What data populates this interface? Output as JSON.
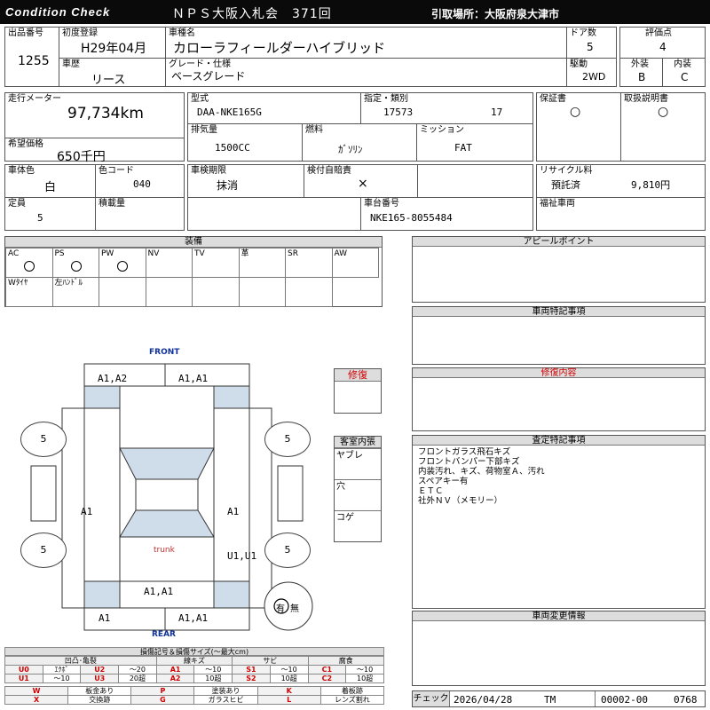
{
  "header": {
    "brand": "Condition  Check",
    "auction": "ＮＰＳ大阪入札会　371回",
    "pickup": "引取場所：大阪府泉大津市"
  },
  "vehicle": {
    "lot_label": "出品番号",
    "lot_no": "1255",
    "first_reg_label": "初度登録",
    "first_reg": "H29年04月",
    "name_label": "車種名",
    "name": "カローラフィールダーハイブリッド",
    "doors_label": "ドア数",
    "doors": "5",
    "score_label": "評価点",
    "score": "4",
    "history_label": "車歴",
    "history": "リース",
    "grade_label": "グレード・仕様",
    "grade": "ベースグレード",
    "drive_label": "駆動",
    "drive": "2WD",
    "exterior_label": "外装",
    "exterior": "B",
    "interior_label": "内装",
    "interior": "C",
    "mileage_label": "走行メーター",
    "mileage": "97,734km",
    "model_label": "型式",
    "model": "DAA-NKE165G",
    "cert_label": "指定・類別",
    "cert_no": "17573",
    "class_no": "17",
    "warranty_label": "保証書",
    "warranty": "○",
    "manual_label": "取扱説明書",
    "manual": "○",
    "price_label": "希望価格",
    "price": "650千円",
    "displacement_label": "排気量",
    "displacement": "1500CC",
    "fuel_label": "燃料",
    "fuel": "ｶﾞｿﾘﾝ",
    "mission_label": "ミッション",
    "mission": "FAT",
    "color_label": "車体色",
    "color": "白",
    "color_code_label": "色コード",
    "color_code": "040",
    "inspection_label": "車検期限",
    "inspection": "抹消",
    "liability_label": "検付自賠責",
    "liability": "×",
    "recycle_label": "リサイクル料",
    "recycle_status": "預託済",
    "recycle_fee": "9,810円",
    "capacity_label": "定員",
    "capacity": "5",
    "load_label": "積載量",
    "chassis_label": "車台番号",
    "chassis": "NKE165-8055484",
    "welfare_label": "福祉車両"
  },
  "equipment": {
    "title": "装備",
    "row1": [
      {
        "label": "AC",
        "mark": "○"
      },
      {
        "label": "PS",
        "mark": "○"
      },
      {
        "label": "PW",
        "mark": "○"
      },
      {
        "label": "NV",
        "mark": ""
      },
      {
        "label": "TV",
        "mark": ""
      },
      {
        "label": "革",
        "mark": ""
      },
      {
        "label": "SR",
        "mark": ""
      },
      {
        "label": "AW",
        "mark": ""
      }
    ],
    "row2": [
      "Wﾀｲﾔ",
      "左ﾊﾝﾄﾞﾙ",
      "",
      "",
      "",
      "",
      ""
    ]
  },
  "diagram": {
    "front": "FRONT",
    "rear": "REAR",
    "trunk": "trunk",
    "front_left": "A1,A2",
    "front_right": "A1,A1",
    "left_side": "A1",
    "right_side": "A1",
    "rear_right_door": "U1,U1",
    "rear_center": "A1,A1",
    "rear_bumper_left": "A1",
    "rear_bumper_right": "A1,A1",
    "tire_fl": "5",
    "tire_fr": "5",
    "tire_rl": "5",
    "tire_rr": "5",
    "spare_yes": "有",
    "spare_no": "無"
  },
  "repair_title": "修復",
  "cabin": {
    "title": "客室内張",
    "items": [
      "ヤブレ",
      "穴",
      "コゲ"
    ]
  },
  "panels": {
    "appeal": {
      "title": "アピールポイント",
      "text": ""
    },
    "special": {
      "title": "車両特記事項",
      "text": ""
    },
    "repair": {
      "title": "修復内容",
      "text": ""
    },
    "inspection_notes": {
      "title": "査定特記事項",
      "lines": [
        "フロントガラス飛石キズ",
        "フロントバンパー下部キズ",
        "内装汚れ、キズ、荷物室Ａ、汚れ",
        "スペアキー有",
        "ＥＴＣ",
        "社外ＮＶ（メモリー）"
      ]
    },
    "changes": {
      "title": "車両変更情報",
      "text": ""
    }
  },
  "legend": {
    "title": "損傷記号＆損傷サイズ(～最大cm)",
    "groups": [
      "凹凸･亀裂",
      "線キズ",
      "サビ",
      "腐食"
    ],
    "row1": [
      "U0",
      "ｴｸﾎﾞ",
      "U2",
      "～20",
      "A1",
      "～10",
      "S1",
      "～10",
      "C1",
      "～10"
    ],
    "row2": [
      "U1",
      "～10",
      "U3",
      "20超",
      "A2",
      "10超",
      "S2",
      "10超",
      "C2",
      "10超"
    ],
    "row3": [
      "W",
      "板金あり",
      "P",
      "塗装あり",
      "K",
      "着板跡"
    ],
    "row4": [
      "X",
      "交換跡",
      "G",
      "ガラスヒビ",
      "L",
      "レンズ割れ"
    ]
  },
  "footer": {
    "check_label": "チェック",
    "date": "2026/04/28",
    "checker": "TM",
    "code": "00002-00",
    "number": "0768"
  }
}
